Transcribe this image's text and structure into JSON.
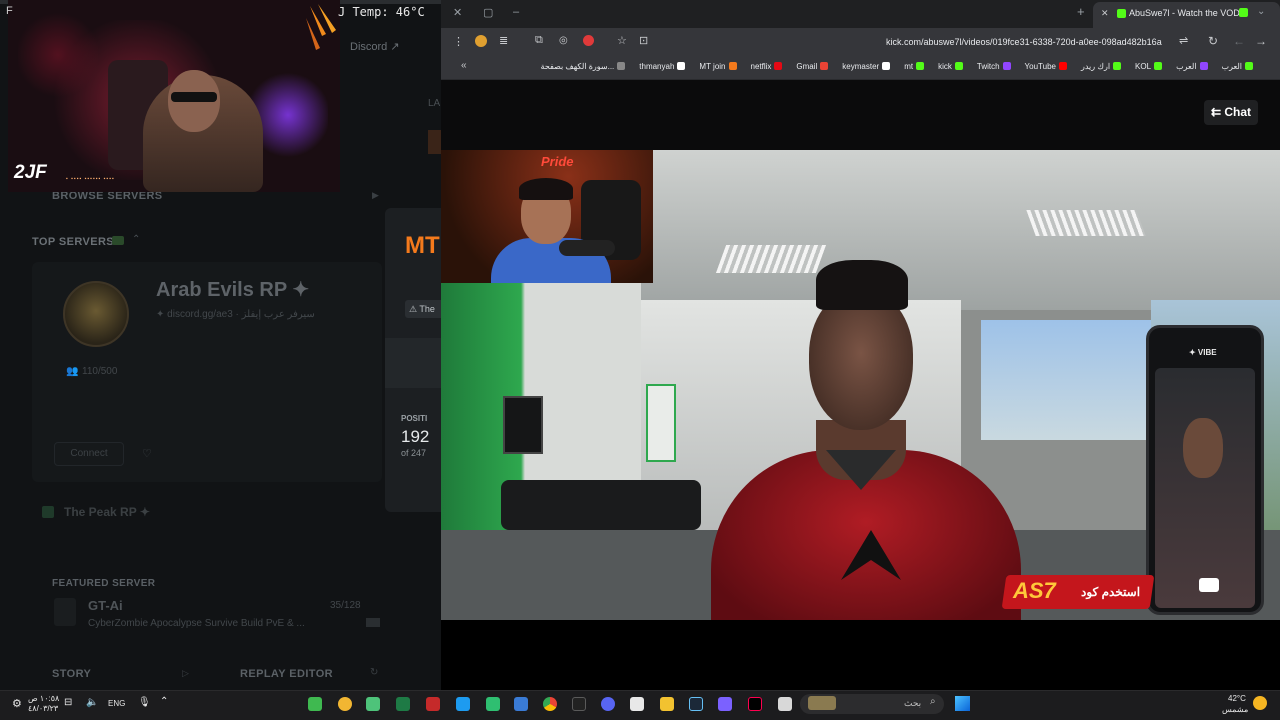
{
  "overlay": {
    "cpu_temp": "J Temp: 46°C",
    "f_char": "F",
    "cam_logo": "2JF",
    "cam_mini": "▪ ▪▪▪▪ ▪▪▪▪▪▪ ▪▪▪▪"
  },
  "launcher": {
    "discord_link": "Discord ↗",
    "browse_servers": "BROWSE SERVERS",
    "top_servers_label": "TOP SERVERS",
    "server_name": "Arab Evils RP ✦",
    "server_invite": "✦ discord.gg/ae3 · سيرفر عرب إيفلز",
    "players": "110/500",
    "connect_label": "Connect",
    "heart_icon": "♡",
    "peak_label": "The Peak RP ✦",
    "featured_label": "FEATURED SERVER",
    "featured_name": "GT-Ai",
    "featured_desc": "CyberZombie Apocalypse Survive Build PvE & ...",
    "featured_players": "35/128",
    "story_label": "STORY",
    "replay_label": "REPLAY EDITOR"
  },
  "queue_dialog": {
    "logo": "MT",
    "chip": "⚠ The",
    "position_label": "POSITI",
    "position_value": "192",
    "position_of": "of 247"
  },
  "browser": {
    "tab_title": "AbuSwe7l - Watch the VOD",
    "url": "kick.com/abuswe7l/videos/019fce31-6338-720d-a0ee-098ad482b16a",
    "bookmarks": [
      {
        "label": "العرب",
        "color": "#53fc18"
      },
      {
        "label": "العرب",
        "color": "#9146ff"
      },
      {
        "label": "KOL",
        "color": "#53fc18"
      },
      {
        "label": "ارك ريدر",
        "color": "#53fc18"
      },
      {
        "label": "YouTube",
        "color": "#ff0000"
      },
      {
        "label": "Twitch",
        "color": "#9146ff"
      },
      {
        "label": "kick",
        "color": "#53fc18"
      },
      {
        "label": "mt",
        "color": "#53fc18"
      },
      {
        "label": "keymaster",
        "color": "#ffffff"
      },
      {
        "label": "Gmail",
        "color": "#ea4335"
      },
      {
        "label": "netflix",
        "color": "#e50914"
      },
      {
        "label": "MT join",
        "color": "#f47a1c"
      },
      {
        "label": "thmanyah",
        "color": "#ffffff"
      },
      {
        "label": "سورة الكهف بصفحة...",
        "color": "#888888"
      }
    ],
    "chat_button": "⇇ Chat"
  },
  "video": {
    "cam_sign": "Pride",
    "phone_app": "✦ VIBE",
    "promo_code": "AS7",
    "promo_text": "استخدم كود"
  },
  "taskbar": {
    "time": "١٠:٥٨ ص",
    "date": "٤٨/٠٣/٢٣",
    "lang": "ENG",
    "search_placeholder": "بحث",
    "weather_temp": "42°C",
    "weather_desc": "مشمس"
  },
  "colors": {
    "kick_green": "#53fc18",
    "accent_orange": "#f47a1c"
  }
}
